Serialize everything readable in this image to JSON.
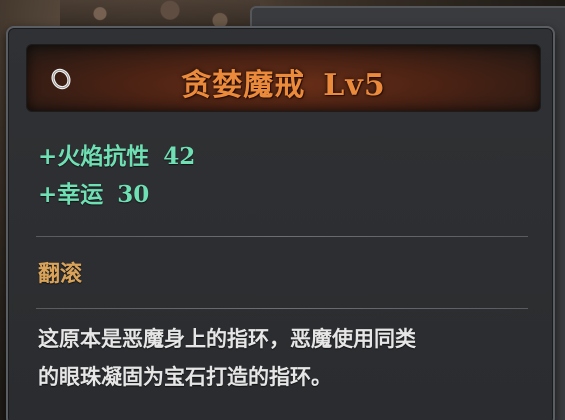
{
  "item": {
    "icon": "ring-icon",
    "name": "贪婪魔戒",
    "level": "Lv5",
    "name_color": "#ec8a3c"
  },
  "stats": [
    {
      "name": "+火焰抗性",
      "value": "42"
    },
    {
      "name": "+幸运",
      "value": "30"
    }
  ],
  "stat_color": "#6fe0b4",
  "skill": {
    "label": "翻滚",
    "color": "#d9a35a"
  },
  "description": {
    "lines": [
      "这原本是恶魔身上的指环，恶魔使用同类",
      "的眼珠凝固为宝石打造的指环。"
    ]
  }
}
